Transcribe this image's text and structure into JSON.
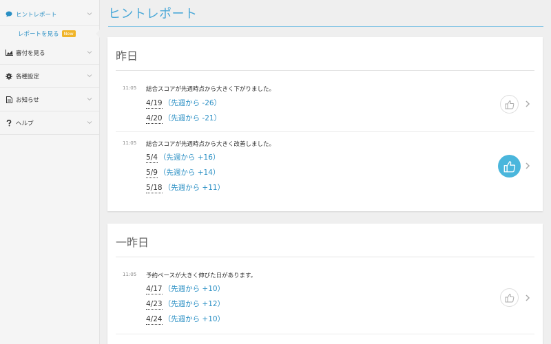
{
  "sidebar": {
    "items": [
      {
        "label": "ヒントレポート",
        "icon": "speech-bubble-icon"
      },
      {
        "label": "審付を見る",
        "icon": "chart-icon"
      },
      {
        "label": "各種設定",
        "icon": "gear-icon"
      },
      {
        "label": "お知らせ",
        "icon": "document-icon"
      },
      {
        "label": "ヘルプ",
        "icon": "question-icon"
      }
    ],
    "sub_item": {
      "label": "レポートを見る",
      "badge": "New"
    }
  },
  "page": {
    "title": "ヒントレポート"
  },
  "sections": [
    {
      "title": "昨日",
      "entries": [
        {
          "time": "11:05",
          "message": "総合スコアが先週時点から大きく下がりました。",
          "rows": [
            {
              "date": "4/19",
              "change": "（先週から -26）"
            },
            {
              "date": "4/20",
              "change": "（先週から -21）"
            }
          ],
          "liked": false
        },
        {
          "time": "11:05",
          "message": "総合スコアが先週時点から大きく改善しました。",
          "rows": [
            {
              "date": "5/4",
              "change": "（先週から +16）"
            },
            {
              "date": "5/9",
              "change": "（先週から +14）"
            },
            {
              "date": "5/18",
              "change": "（先週から +11）"
            }
          ],
          "liked": true
        }
      ]
    },
    {
      "title": "一昨日",
      "entries": [
        {
          "time": "11:05",
          "message": "予約ペースが大きく伸びた日があります。",
          "rows": [
            {
              "date": "4/17",
              "change": "（先週から +10）"
            },
            {
              "date": "4/23",
              "change": "（先週から +12）"
            },
            {
              "date": "4/24",
              "change": "（先週から +10）"
            }
          ],
          "liked": false
        }
      ]
    }
  ],
  "colors": {
    "accent": "#2a8fc4",
    "title": "#4aa8d8",
    "like_active": "#4ab6dc",
    "badge": "#f0b429"
  }
}
